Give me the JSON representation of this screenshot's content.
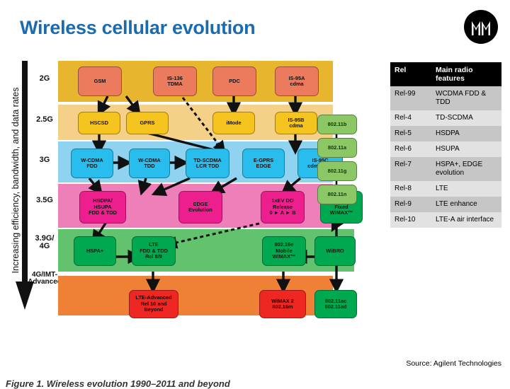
{
  "header": {
    "title": "Wireless cellular evolution",
    "logo_name": "motorola-logo",
    "title_color": "#1a6bb0"
  },
  "figure": {
    "axis_label": "Increasing efficiency, bandwidth, and data rates",
    "caption": "Figure 1. Wireless evolution 1990–2011 and beyond",
    "generations": [
      {
        "label": "2G",
        "band_color": "#e8b52e"
      },
      {
        "label": "2.5G",
        "band_color": "#f5d089"
      },
      {
        "label": "3G",
        "band_color": "#8fd3f0"
      },
      {
        "label": "3.5G",
        "band_color": "#ef7fb8"
      },
      {
        "label": "3.9G/\n4G",
        "band_color": "#62c26e"
      },
      {
        "label": "4G/IMT-\nAdvanced",
        "band_color": "#ee8136"
      }
    ],
    "gen_labels": [
      "2G",
      "2.5G",
      "3G",
      "3.5G",
      "3.9G/",
      "4G",
      "4G/IMT-",
      "Advanced"
    ],
    "boxes": {
      "gsm": "GSM",
      "is136": "IS-136\nTDMA",
      "pdc": "PDC",
      "is95a": "IS-95A\ncdma",
      "hscsd": "HSCSD",
      "gprs": "GPRS",
      "imode": "iMode",
      "is95b": "IS-95B\ncdma",
      "wcdma_fdd": "W-CDMA\nFDD",
      "wcdma_tdd": "W-CDMA\nTDD",
      "td_scdma": "TD-SCDMA\nLCR TDD",
      "egprs": "E-GPRS\nEDGE",
      "is95c": "IS-95C\ncdma2000",
      "hsdpa": "HSDPA/\nHSUPA\nFDD & TDD",
      "edge_evo": "EDGE\nEvolution",
      "evdo": "1xEV DO\nRelease\n0 ► A ► B",
      "hspa_plus": "HSPA+",
      "lte": "LTE\nFDD & TDD\nRel 8/9",
      "wimax_mobile": "802.16e\nMobile\nWiMAX™",
      "wibro": "WiBRO",
      "lte_advanced": "LTE-Advanced\nRel 10 and\nBeyond",
      "wimax2": "WiMAX 2\n802.16m",
      "wimax_fixed": "802.16d\nFixed\nWiMAX™",
      "wifi_b": "802.11b",
      "wifi_a": "802.11a",
      "wifi_g": "802.11g",
      "wifi_n": "802.11n",
      "wifi_acad": "802.11ac\n802.11ad"
    }
  },
  "table": {
    "headers": [
      "Rel",
      "Main radio features"
    ],
    "header_col1": "Rel",
    "header_col2": "Main radio features",
    "rows": [
      {
        "rel": "Rel-99",
        "features": "WCDMA FDD & TDD"
      },
      {
        "rel": "Rel-4",
        "features": "TD-SCDMA"
      },
      {
        "rel": "Rel-5",
        "features": "HSDPA"
      },
      {
        "rel": "Rel-6",
        "features": "HSUPA"
      },
      {
        "rel": "Rel-7",
        "features": "HSPA+, EDGE evolution"
      },
      {
        "rel": "Rel-8",
        "features": "LTE"
      },
      {
        "rel": "Rel-9",
        "features": "LTE enhance"
      },
      {
        "rel": "Rel-10",
        "features": "LTE-A air interface"
      }
    ]
  },
  "source_note": "Source: Agilent Technologies"
}
